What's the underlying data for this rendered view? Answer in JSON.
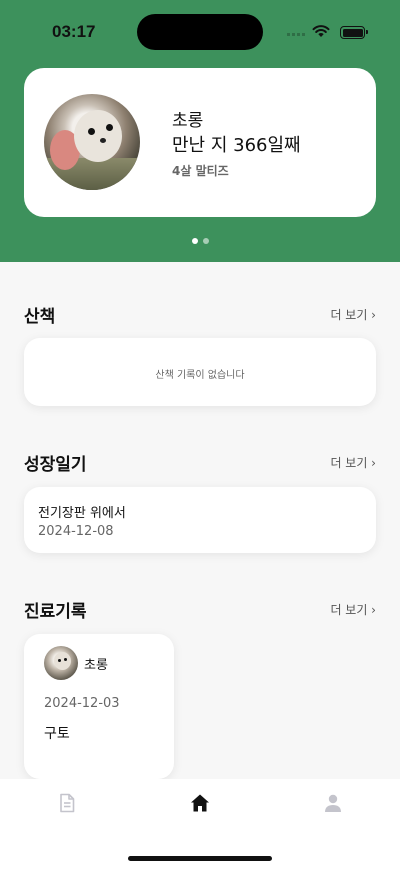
{
  "status_bar": {
    "time": "03:17"
  },
  "profile": {
    "name": "초롱",
    "days_together": "만난 지 366일째",
    "info": "4살 말티즈",
    "pager_pages": 2,
    "pager_active": 1
  },
  "sections": {
    "walk": {
      "title": "산책",
      "more": "더 보기 ›",
      "empty_text": "산책 기록이 없습니다"
    },
    "growth": {
      "title": "성장일기",
      "more": "더 보기 ›",
      "entries": [
        {
          "title": "전기장판 위에서",
          "date": "2024-12-08"
        }
      ]
    },
    "medical": {
      "title": "진료기록",
      "more": "더 보기 ›",
      "records": [
        {
          "pet_name": "초롱",
          "date": "2024-12-03",
          "symptom": "구토"
        }
      ]
    }
  },
  "tab_bar": {
    "items": [
      {
        "icon": "document-icon",
        "active": false
      },
      {
        "icon": "home-icon",
        "active": true
      },
      {
        "icon": "person-icon",
        "active": false
      }
    ]
  },
  "colors": {
    "header_green": "#3d915c",
    "inactive_tab": "#c4c4cc",
    "active_tab": "#111111"
  }
}
